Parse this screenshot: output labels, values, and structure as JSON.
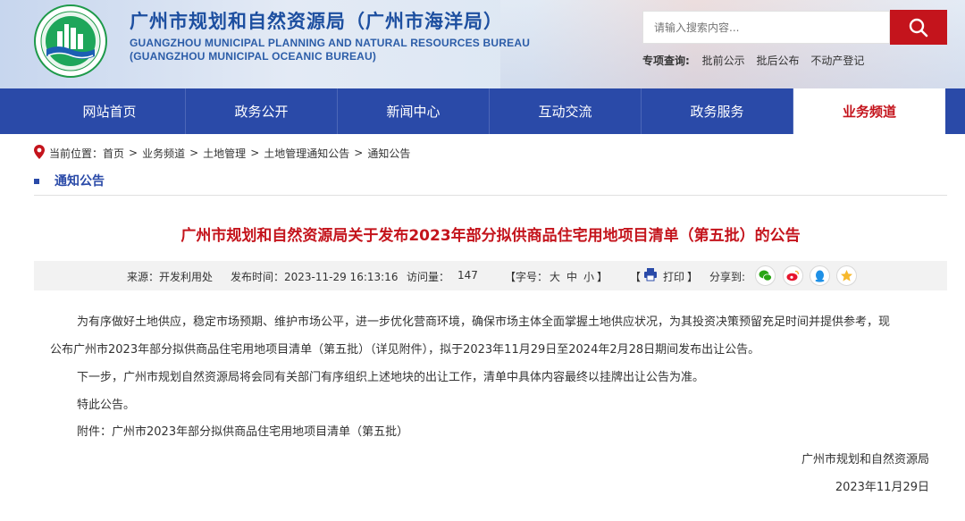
{
  "header": {
    "title_cn": "广州市规划和自然资源局（广州市海洋局）",
    "title_en_line1": "GUANGZHOU MUNICIPAL PLANNING AND NATURAL RESOURCES BUREAU",
    "title_en_line2": "(GUANGZHOU MUNICIPAL OCEANIC BUREAU)",
    "logo_icon": "bureau-emblem-icon"
  },
  "search": {
    "placeholder": "请输入搜索内容...",
    "button_icon": "search-icon"
  },
  "topics": {
    "label": "专项查询:",
    "links": [
      "批前公示",
      "批后公布",
      "不动产登记"
    ]
  },
  "nav": {
    "items": [
      {
        "label": "网站首页"
      },
      {
        "label": "政务公开"
      },
      {
        "label": "新闻中心"
      },
      {
        "label": "互动交流"
      },
      {
        "label": "政务服务"
      },
      {
        "label": "业务频道"
      }
    ],
    "active_index": 5
  },
  "breadcrumb": {
    "prefix": "当前位置：",
    "items": [
      "首页",
      "业务频道",
      "土地管理",
      "土地管理通知公告",
      "通知公告"
    ],
    "separator": ">"
  },
  "section": {
    "title": "通知公告"
  },
  "article": {
    "title": "广州市规划和自然资源局关于发布2023年部分拟供商品住宅用地项目清单（第五批）的公告",
    "meta": {
      "source": "来源：开发利用处",
      "publish_time": "发布时间：2023-11-29 16:13:16",
      "visits_label": "访问量：",
      "visits_value": "147",
      "font_label": "【字号：",
      "font_big": "大",
      "font_mid": "中",
      "font_small": "小",
      "font_end": "】",
      "print_open": "【",
      "print_label": "打印",
      "print_close": "】",
      "share_label": "分享到:"
    },
    "paragraphs": {
      "p1_line1": "为有序做好土地供应，稳定市场预期、维护市场公平，进一步优化营商环境，确保市场主体全面掌握土地供应状况，为其投资决策预留充足时间并提供参考，现",
      "p1_line2": "公布广州市2023年部分拟供商品住宅用地项目清单（第五批）（详见附件），拟于2023年11月29日至2024年2月28日期间发布出让公告。",
      "p2": "下一步，广州市规划自然资源局将会同有关部门有序组织上述地块的出让工作，清单中具体内容最终以挂牌出让公告为准。",
      "p3": "特此公告。",
      "attachment": "附件：广州市2023年部分拟供商品住宅用地项目清单（第五批）"
    },
    "signature": "广州市规划和自然资源局",
    "date": "2023年11月29日"
  },
  "colors": {
    "brand_blue": "#2a4aa8",
    "accent_red": "#c4141c"
  }
}
